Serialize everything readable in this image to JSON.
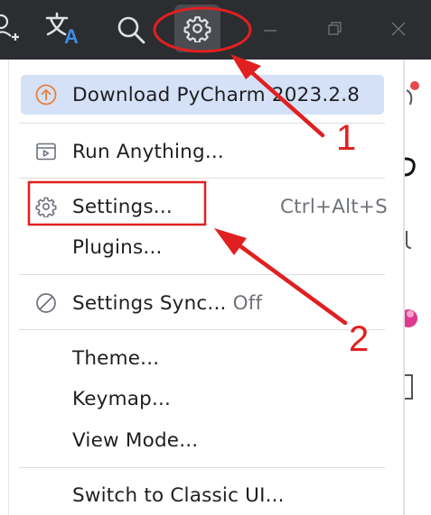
{
  "menu": {
    "items": [
      {
        "label": "Download PyCharm 2023.2.8",
        "icon": "arrow-up-circle-icon"
      },
      {
        "label": "Run Anything...",
        "icon": "run-anything-icon"
      },
      {
        "label": "Settings...",
        "shortcut": "Ctrl+Alt+S",
        "icon": "gear-icon"
      },
      {
        "label": "Plugins..."
      },
      {
        "label": "Settings Sync...",
        "status": "Off",
        "icon": "sync-off-icon"
      },
      {
        "label": "Theme..."
      },
      {
        "label": "Keymap..."
      },
      {
        "label": "View Mode..."
      },
      {
        "label": "Switch to Classic UI..."
      }
    ]
  },
  "annotations": {
    "label_1": "1",
    "label_2": "2",
    "color": "#e02020"
  },
  "colors": {
    "titlebar": "#2b2d30",
    "highlight": "#d5e1f7",
    "download_accent": "#e8813a"
  }
}
